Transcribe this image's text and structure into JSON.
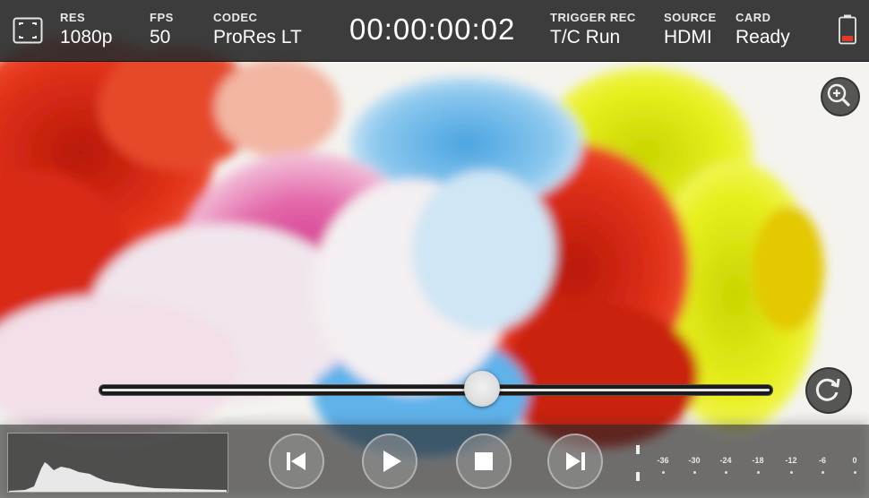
{
  "status_bar": {
    "res": {
      "label": "RES",
      "value": "1080p"
    },
    "fps": {
      "label": "FPS",
      "value": "50"
    },
    "codec": {
      "label": "CODEC",
      "value": "ProRes LT"
    },
    "timecode": "00:00:00:02",
    "trigger": {
      "label": "TRIGGER REC",
      "value": "T/C Run"
    },
    "source": {
      "label": "SOURCE",
      "value": "HDMI"
    },
    "card": {
      "label": "CARD",
      "value": "Ready"
    }
  },
  "icons": {
    "frame_guides": "frame-guides-icon",
    "battery": "battery-icon",
    "zoom": "zoom-in-icon",
    "loop": "loop-icon",
    "prev": "skip-previous-icon",
    "play": "play-icon",
    "stop": "stop-icon",
    "next": "skip-next-icon"
  },
  "playback": {
    "scrub_position_fraction": 0.57
  },
  "audio_meter": {
    "ticks": [
      "-36",
      "-30",
      "-24",
      "-18",
      "-12",
      "-6",
      "0"
    ]
  },
  "colors": {
    "accent_battery": "#e03a2a",
    "bar_bg": "#2c2c2c"
  }
}
